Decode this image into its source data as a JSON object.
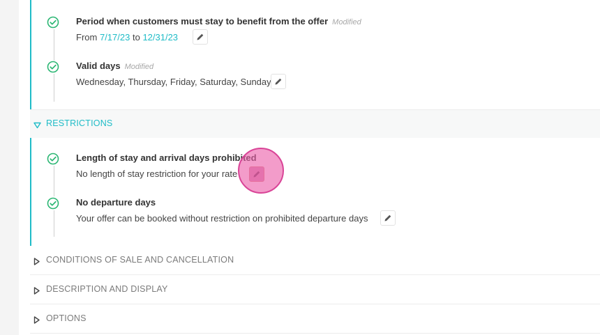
{
  "offer_sections": {
    "period": {
      "title": "Period when customers must stay to benefit from the offer",
      "modified": "Modified",
      "from_label": "From",
      "from_date": "7/17/23",
      "to_label": "to",
      "to_date": "12/31/23"
    },
    "valid_days": {
      "title": "Valid days",
      "modified": "Modified",
      "value": "Wednesday, Thursday, Friday, Saturday, Sunday"
    },
    "restrictions": {
      "header": "RESTRICTIONS",
      "accent_color": "#1fbcc7",
      "items": [
        {
          "title": "Length of stay and arrival days prohibited",
          "description": "No length of stay restriction for your rate"
        },
        {
          "title": "No departure days",
          "description": "Your offer can be booked without restriction on prohibited departure days"
        }
      ]
    },
    "collapsed": [
      {
        "label": "CONDITIONS OF SALE AND CANCELLATION"
      },
      {
        "label": "DESCRIPTION AND DISPLAY"
      },
      {
        "label": "OPTIONS"
      }
    ]
  },
  "icons": {
    "check": "check-circle-icon",
    "edit": "pencil-icon",
    "expanded": "triangle-down-icon",
    "collapsed": "triangle-right-icon"
  },
  "colors": {
    "accent": "#1fbcc7",
    "check_green": "#2bb673",
    "cursor_highlight": "#ec60aa"
  }
}
